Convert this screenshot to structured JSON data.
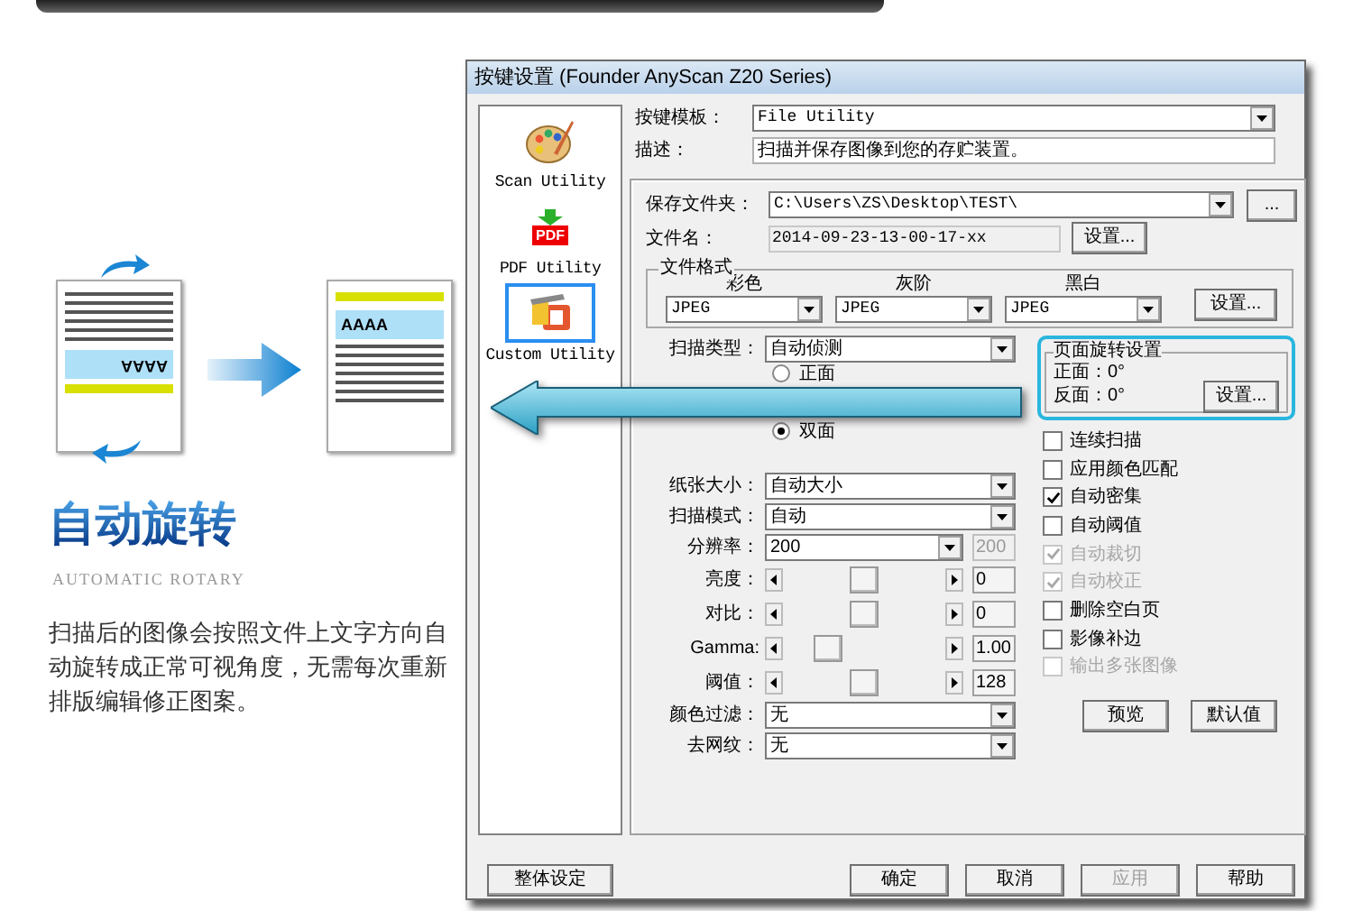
{
  "illustration": {
    "before_text": "AAAA",
    "after_text": "AAAA"
  },
  "feature": {
    "title": "自动旋转",
    "subtitle": "AUTOMATIC ROTARY",
    "description": "扫描后的图像会按照文件上文字方向自动旋转成正常可视角度，无需每次重新排版编辑修正图案。"
  },
  "dialog": {
    "title": "按键设置 (Founder AnyScan Z20 Series)",
    "sidebar": [
      {
        "label": "Scan Utility",
        "kind": "palette",
        "selected": false
      },
      {
        "label": "PDF Utility",
        "kind": "pdf",
        "icon_text": "PDF",
        "selected": false
      },
      {
        "label": "Custom Utility",
        "kind": "tools",
        "selected": true
      }
    ],
    "template": {
      "label": "按键模板：",
      "value": "File Utility"
    },
    "description": {
      "label": "描述：",
      "value": "扫描并保存图像到您的存贮装置。"
    },
    "folder": {
      "label": "保存文件夹：",
      "value": "C:\\Users\\ZS\\Desktop\\TEST\\",
      "button": "..."
    },
    "filename": {
      "label": "文件名：",
      "value": "2014-09-23-13-00-17-xx",
      "button": "设置..."
    },
    "format": {
      "title": "文件格式",
      "columns": [
        {
          "label": "彩色",
          "value": "JPEG"
        },
        {
          "label": "灰阶",
          "value": "JPEG"
        },
        {
          "label": "黑白",
          "value": "JPEG"
        }
      ],
      "button": "设置..."
    },
    "scan_type": {
      "label": "扫描类型：",
      "value": "自动侦测"
    },
    "sides": [
      {
        "label": "正面",
        "selected": false
      },
      {
        "label": "双面",
        "selected": true
      }
    ],
    "fields": [
      {
        "kind": "select",
        "label": "纸张大小：",
        "value": "自动大小"
      },
      {
        "kind": "select",
        "label": "扫描模式：",
        "value": "自动"
      },
      {
        "kind": "select_value",
        "label": "分辨率：",
        "value": "200",
        "readout": "200"
      },
      {
        "kind": "slider",
        "label": "亮度：",
        "level": 0.5,
        "readout": "0"
      },
      {
        "kind": "slider",
        "label": "对比：",
        "level": 0.5,
        "readout": "0"
      },
      {
        "kind": "slider",
        "label": "Gamma:",
        "level": 0.27,
        "readout": "1.00"
      },
      {
        "kind": "slider",
        "label": "阈值：",
        "level": 0.5,
        "readout": "128"
      },
      {
        "kind": "select",
        "label": "颜色过滤：",
        "value": "无"
      },
      {
        "kind": "select",
        "label": "去网纹：",
        "value": "无"
      }
    ],
    "rotation": {
      "title": "页面旋转设置",
      "front": "正面：0°",
      "back": "反面：0°",
      "button": "设置..."
    },
    "options": [
      {
        "label": "连续扫描",
        "checked": false,
        "disabled": false
      },
      {
        "label": "应用颜色匹配",
        "checked": false,
        "disabled": false
      },
      {
        "label": "自动密集",
        "checked": true,
        "disabled": false
      },
      {
        "label": "自动阈值",
        "checked": false,
        "disabled": false
      },
      {
        "label": "自动裁切",
        "checked": true,
        "disabled": true
      },
      {
        "label": "自动校正",
        "checked": true,
        "disabled": true
      },
      {
        "label": "删除空白页",
        "checked": false,
        "disabled": false
      },
      {
        "label": "影像补边",
        "checked": false,
        "disabled": false
      },
      {
        "label": "输出多张图像",
        "checked": false,
        "disabled": true
      }
    ],
    "side_buttons": [
      "预览",
      "默认值"
    ],
    "global_button": "整体设定",
    "buttons": [
      {
        "label": "确定",
        "disabled": false
      },
      {
        "label": "取消",
        "disabled": false
      },
      {
        "label": "应用",
        "disabled": true
      },
      {
        "label": "帮助",
        "disabled": false
      }
    ]
  }
}
